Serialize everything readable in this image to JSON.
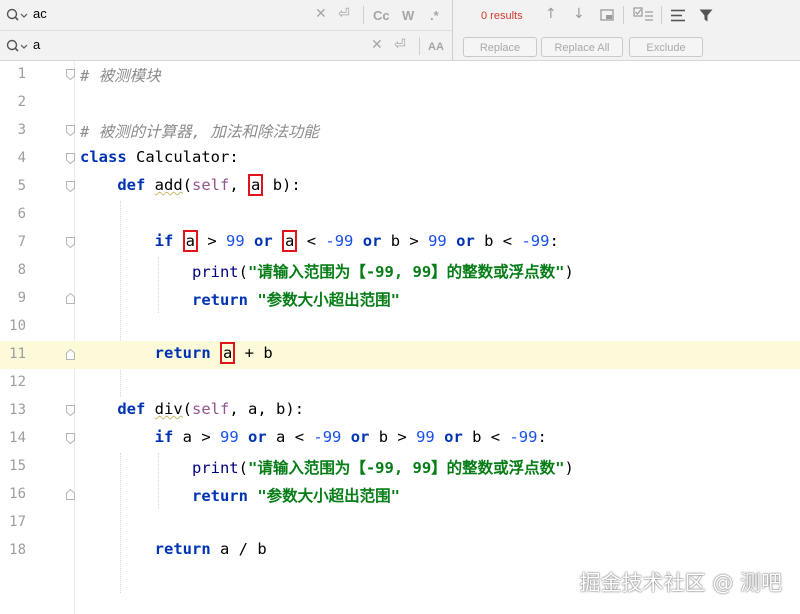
{
  "find": {
    "search_value": "ac",
    "replace_value": "a",
    "results_text": "0 results",
    "case_icon": "Cc",
    "word_icon": "W",
    "regex_icon": ".*",
    "preserve_case_icon": "AA",
    "buttons": {
      "replace": "Replace",
      "replace_all": "Replace All",
      "exclude": "Exclude"
    }
  },
  "lines": [
    {
      "n": "1"
    },
    {
      "n": "2"
    },
    {
      "n": "3"
    },
    {
      "n": "4"
    },
    {
      "n": "5"
    },
    {
      "n": "6"
    },
    {
      "n": "7"
    },
    {
      "n": "8"
    },
    {
      "n": "9"
    },
    {
      "n": "10"
    },
    {
      "n": "11"
    },
    {
      "n": "12"
    },
    {
      "n": "13"
    },
    {
      "n": "14"
    },
    {
      "n": "15"
    },
    {
      "n": "16"
    },
    {
      "n": "17"
    },
    {
      "n": "18"
    }
  ],
  "code": {
    "l1_comment": "# 被测模块",
    "l3_comment": "# 被测的计算器, 加法和除法功能",
    "l4_kw": "class",
    "l4_rest": " Calculator:",
    "def": "def",
    "add_name": "add",
    "div_name": "div",
    "self": "self",
    "a": "a",
    "b": "b",
    "if": "if",
    "or": "or",
    "n99": "99",
    "nm99": "-99",
    "print": "print",
    "print_str": "\"请输入范围为【-99, 99】的整数或浮点数\"",
    "return": "return",
    "return_str": "\"参数大小超出范围\""
  },
  "watermark": "掘金技术社区 @ 测吧",
  "colors": {
    "keyword": "#0033b3",
    "number": "#1750eb",
    "string": "#067d17",
    "highlight_box": "#e0141a",
    "current_line": "#fcfad9",
    "results": "#d13b2e"
  }
}
